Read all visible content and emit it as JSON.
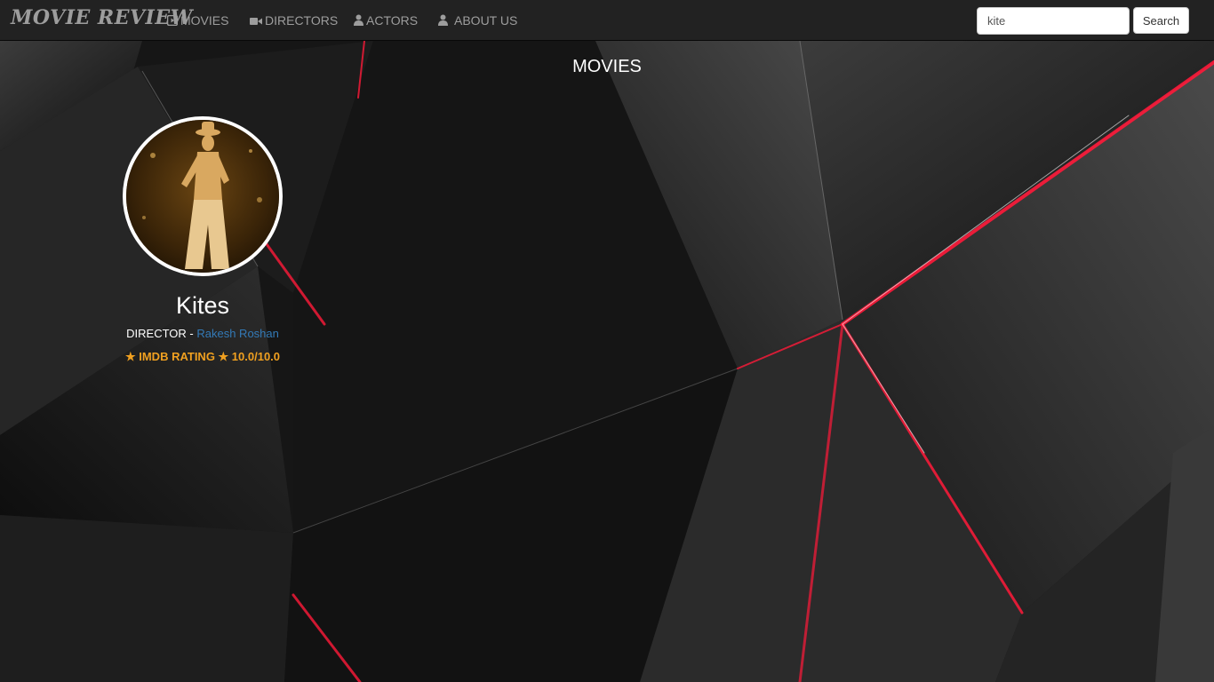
{
  "nav": {
    "brand": "MOVIE REVIEW",
    "items": [
      {
        "label": "MOVIES",
        "icon": "film-icon"
      },
      {
        "label": "DIRECTORS",
        "icon": "video-camera-icon"
      },
      {
        "label": "ACTORS",
        "icon": "user-icon"
      },
      {
        "label": "ABOUT US",
        "icon": "user-icon"
      }
    ],
    "search": {
      "value": "kite",
      "button_label": "Search"
    }
  },
  "main": {
    "title": "MOVIES",
    "movie": {
      "title": "Kites",
      "director_prefix": "DIRECTOR - ",
      "director_name": "Rakesh Roshan",
      "rating_text": "★ IMDB RATING ★ 10.0/10.0",
      "poster_icon": "movie-poster"
    }
  },
  "colors": {
    "navbar_bg": "#222222",
    "nav_text": "#9d9d9d",
    "link": "#337ab7",
    "rating": "#f0a020",
    "background": "#161616",
    "glow": "#ff1a3a"
  }
}
